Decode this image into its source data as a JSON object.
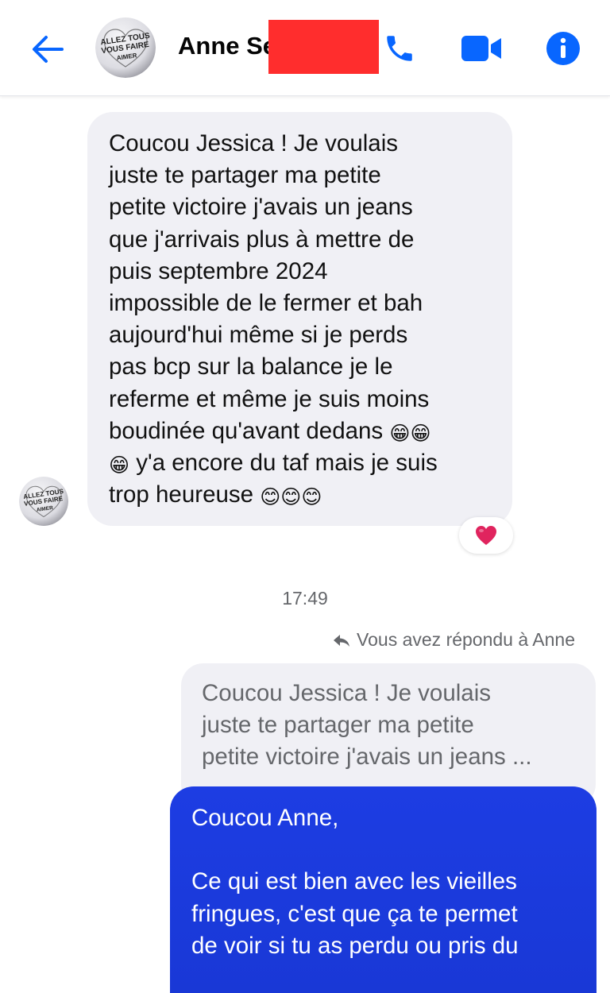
{
  "header": {
    "contact_name": "Anne Se",
    "avatar_text": [
      "ALLEZ TOUS",
      "VOUS FAIRE",
      "AIMER"
    ]
  },
  "incoming_message": {
    "lines": [
      "Coucou Jessica ! Je voulais",
      "juste te partager ma petite",
      "petite victoire j'avais un jeans",
      "que j'arrivais plus à mettre de",
      "puis septembre 2024",
      "impossible de le fermer et bah",
      "aujourd'hui même si je perds",
      "pas bcp sur la balance je le",
      "referme et même je suis moins",
      "boudinée qu'avant dedans",
      "y'a encore du taf mais je suis",
      "trop heureuse"
    ],
    "emoji_grin_double": "😁😁",
    "emoji_grin_single": "😁",
    "emoji_smile_triple": "😊😊😊",
    "reaction": "❤️"
  },
  "timestamp": "17:49",
  "reply_context": {
    "label": "Vous avez répondu à Anne",
    "quoted_lines": [
      "Coucou Jessica ! Je voulais",
      "juste te partager ma petite",
      "petite victoire j'avais un jeans ..."
    ]
  },
  "outgoing_message": {
    "lines": [
      "Coucou Anne,",
      "",
      "Ce qui est bien avec les vieilles",
      "fringues, c'est que ça te permet",
      "de voir si tu as perdu ou pris du"
    ]
  },
  "colors": {
    "accent": "#0866ff",
    "outgoing_bubble": "#1d3de3",
    "incoming_bubble": "#f0f0f5",
    "secondary_text": "#65676b",
    "redaction": "#ff2d2d"
  },
  "icons": {
    "back": "arrow-left-icon",
    "call": "phone-icon",
    "video": "video-camera-icon",
    "info": "info-icon",
    "reply": "reply-arrow-icon"
  }
}
